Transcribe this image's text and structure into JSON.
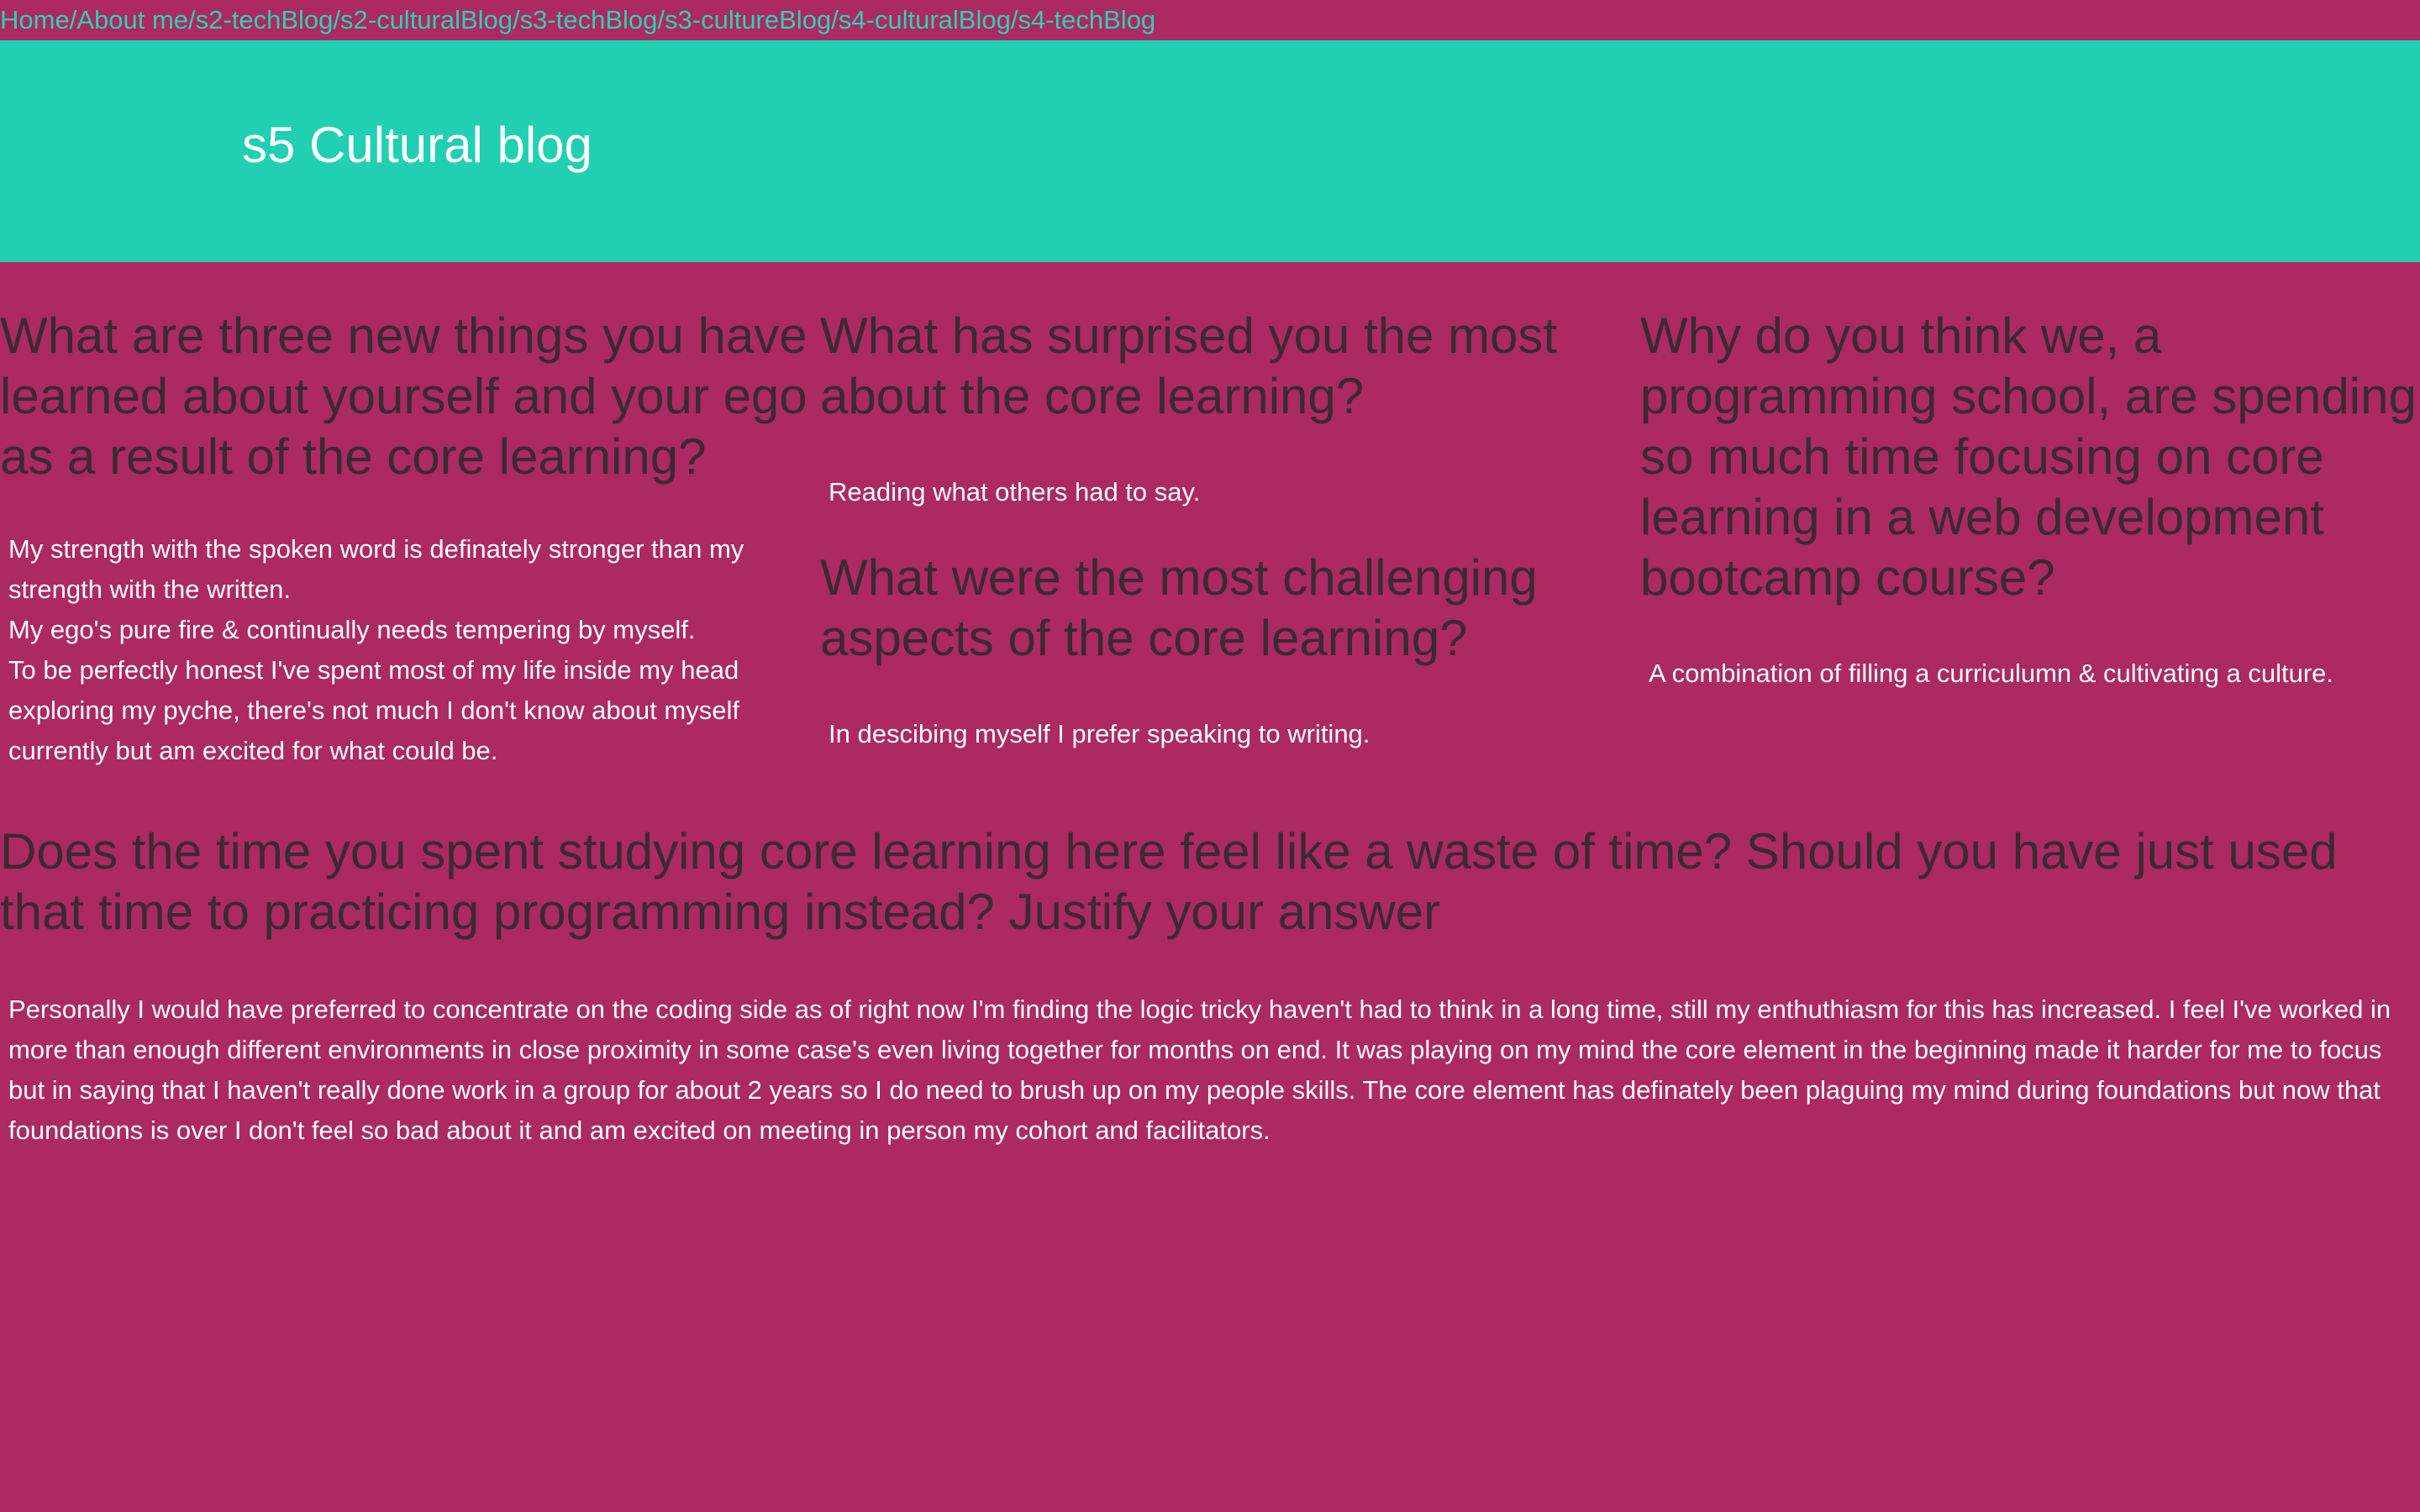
{
  "nav": {
    "links": [
      "Home",
      "About me",
      "s2-techBlog",
      "s2-culturalBlog",
      "s3-techBlog",
      "s3-cultureBlog",
      "s4-culturalBlog",
      "s4-techBlog"
    ],
    "separator": " / "
  },
  "header": {
    "title": "s5 Cultural blog"
  },
  "sections": {
    "col1": {
      "question": "What are three new things you have learned about yourself and your ego as a result of the core learning?",
      "answer_lines": [
        "My strength with the spoken word is definately stronger than my strength with the written.",
        "My ego's pure fire & continually needs tempering by myself.",
        "To be perfectly honest I've spent most of my life inside my head exploring my pyche, there's not much I don't know about myself currently but am excited for what could be."
      ]
    },
    "col2": {
      "q1": "What has surprised you the most about the core learning?",
      "a1": "Reading what others had to say.",
      "q2": "What were the most challenging aspects of the core learning?",
      "a2": "In descibing myself I prefer speaking to writing."
    },
    "col3": {
      "question": "Why do you think we, a programming school, are spending so much time focusing on core learning in a web development bootcamp course?",
      "answer": "A combination of filling a curriculumn & cultivating a culture."
    },
    "wide": {
      "question": "Does the time you spent studying core learning here feel like a waste of time? Should you have just used that time to practicing programming instead? Justify your answer",
      "answer": "Personally I would have preferred to concentrate on the coding side as of right now I'm finding the logic tricky haven't had to think in a long time, still my enthuthiasm for this has increased. I feel I've worked in more than enough different environments in close proximity in some case's even living together for months on end. It was playing on my mind the core element in the beginning made it harder for me to focus but in saying that I haven't really done work in a group for about 2 years so I do need to brush up on my people skills. The core element has definately been plaguing my mind during foundations but now that foundations is over I don't feel so bad about it and am excited on meeting in person my cohort and facilitators."
    }
  },
  "colors": {
    "background": "#ac2962",
    "header_bg": "#21d0b2",
    "link": "#2ed1b3",
    "question_text": "#3a2a33",
    "answer_text": "#ffffff"
  }
}
